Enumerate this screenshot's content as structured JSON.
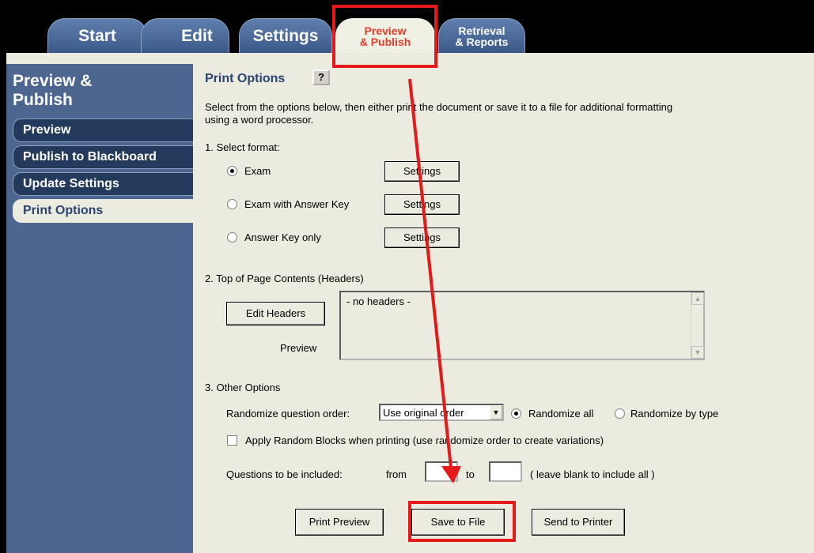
{
  "tabs": [
    {
      "label": "Start"
    },
    {
      "label": "Edit"
    },
    {
      "label": "Settings"
    },
    {
      "line1": "Preview",
      "line2": "& Publish",
      "active": true
    },
    {
      "line1": "Retrieval",
      "line2": "& Reports"
    }
  ],
  "sidebar": {
    "title_line1": "Preview &",
    "title_line2": "Publish",
    "items": [
      {
        "label": "Preview"
      },
      {
        "label": "Publish to Blackboard"
      },
      {
        "label": "Update Settings"
      },
      {
        "label": "Print Options",
        "active": true
      }
    ]
  },
  "main": {
    "title": "Print Options",
    "help_label": "?",
    "intro_line1": "Select from the options below, then either print the document or save it to a file for additional formatting",
    "intro_line2": "using a word processor.",
    "section1": {
      "label": "1.  Select format:",
      "options": [
        {
          "label": "Exam",
          "selected": true,
          "button": "Settings"
        },
        {
          "label": "Exam with Answer Key",
          "selected": false,
          "button": "Settings"
        },
        {
          "label": "Answer Key only",
          "selected": false,
          "button": "Settings"
        }
      ]
    },
    "section2": {
      "label": "2.  Top of Page Contents (Headers)",
      "edit_button": "Edit Headers",
      "preview_label": "Preview",
      "headers_text": "- no headers -"
    },
    "section3": {
      "label": "3.  Other Options",
      "randomize_label": "Randomize question order:",
      "randomize_select": "Use original order",
      "randomize_all": "Randomize all",
      "randomize_all_selected": true,
      "randomize_by_type": "Randomize by type",
      "random_blocks_label": "Apply Random Blocks when printing (use randomize order to create variations)",
      "random_blocks_checked": false,
      "questions_label": "Questions to be included:",
      "from_label": "from",
      "from_value": "",
      "to_label": "to",
      "to_value": "",
      "hint": "( leave blank to include all )"
    },
    "buttons": {
      "print_preview": "Print Preview",
      "save_to_file": "Save to File",
      "send_to_printer": "Send to Printer"
    }
  },
  "annotation_color": "#e41a1a"
}
